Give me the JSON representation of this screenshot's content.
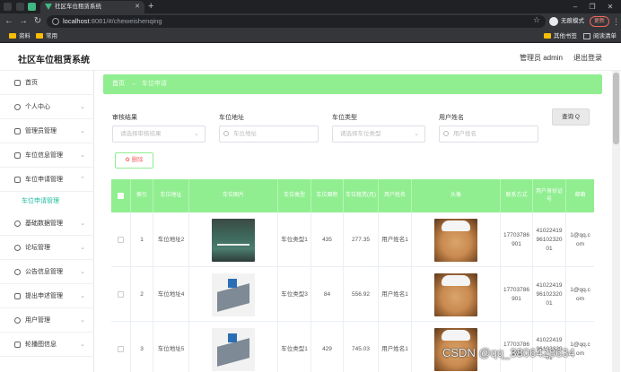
{
  "browser": {
    "tab_title": "社区车位租赁系统",
    "url_host": "localhost",
    "url_path": ":8081/#/cheweishenqing",
    "incognito_label": "无痕模式",
    "update_label": "更新",
    "bookmarks": [
      "资料",
      "常用"
    ],
    "bookmarks_right": [
      "其他书签",
      "阅读清单"
    ]
  },
  "header": {
    "title": "社区车位租赁系统",
    "admin": "管理员 admin",
    "logout": "退出登录"
  },
  "sidebar": {
    "items": [
      {
        "label": "首页",
        "icon": "home-icon",
        "arrow": false
      },
      {
        "label": "个人中心",
        "icon": "user-icon",
        "arrow": true
      },
      {
        "label": "管理员管理",
        "icon": "mic-icon",
        "arrow": true
      },
      {
        "label": "车位信息管理",
        "icon": "chart-icon",
        "arrow": true
      },
      {
        "label": "车位申请管理",
        "icon": "doc-icon",
        "arrow": true
      },
      {
        "label": "基础数据管理",
        "icon": "compass-icon",
        "arrow": true
      },
      {
        "label": "论坛管理",
        "icon": "chat-icon",
        "arrow": true
      },
      {
        "label": "公告信息管理",
        "icon": "clock-icon",
        "arrow": true
      },
      {
        "label": "提出申述管理",
        "icon": "box-icon",
        "arrow": true
      },
      {
        "label": "用户管理",
        "icon": "globe-icon",
        "arrow": true
      },
      {
        "label": "轮播图信息",
        "icon": "list-icon",
        "arrow": true
      }
    ],
    "active_sub": "车位申请管理"
  },
  "breadcrumb": {
    "home": "首页",
    "sep": "→",
    "current": "车位申请"
  },
  "filters": {
    "status_label": "审核结果",
    "status_placeholder": "请选择审核结果",
    "address_label": "车位地址",
    "address_placeholder": "车位地址",
    "type_label": "车位类型",
    "type_placeholder": "请选择车位类型",
    "username_label": "用户姓名",
    "username_placeholder": "用户姓名",
    "query_button": "查询 Q",
    "delete_button": "✿ 删除"
  },
  "table": {
    "headers": [
      "",
      "索引",
      "车位地址",
      "车位图片",
      "车位类型",
      "车位面积",
      "车位租赁(月)",
      "用户姓名",
      "头像",
      "联系方式",
      "用户身份证号",
      "邮箱"
    ],
    "rows": [
      {
        "index": "1",
        "address": "车位地址2",
        "image": "park-photo",
        "type": "车位类型1",
        "area": "435",
        "rent": "277.35",
        "username": "用户姓名1",
        "phone": "17703786901",
        "idcard": "410224199610232001",
        "email": "1@qq.com"
      },
      {
        "index": "2",
        "address": "车位地址4",
        "image": "park-3d",
        "type": "车位类型3",
        "area": "84",
        "rent": "556.92",
        "username": "用户姓名1",
        "phone": "17703786901",
        "idcard": "410224199610232001",
        "email": "1@qq.com"
      },
      {
        "index": "3",
        "address": "车位地址5",
        "image": "park-3d",
        "type": "车位类型1",
        "area": "429",
        "rent": "745.03",
        "username": "用户姓名1",
        "phone": "17703786901",
        "idcard": "410224199610232001",
        "email": "1@qq.com"
      }
    ]
  },
  "watermark": "CSDN @qq_3806428634"
}
